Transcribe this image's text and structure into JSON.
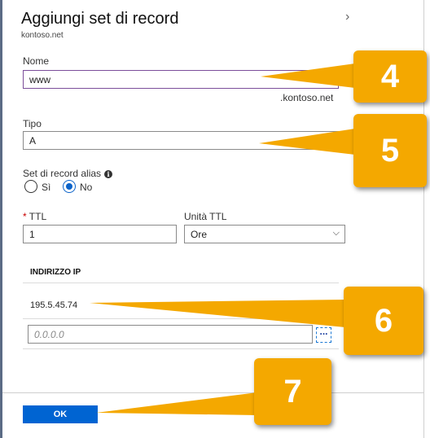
{
  "panel": {
    "title": "Aggiungi set di record",
    "subtitle": "kontoso.net",
    "close_glyph": "›"
  },
  "nome": {
    "label": "Nome",
    "value": "www",
    "suffix": ".kontoso.net"
  },
  "tipo": {
    "label": "Tipo",
    "value": "A"
  },
  "alias": {
    "label": "Set di record alias",
    "info_icon": "info-icon",
    "options": [
      {
        "label": "Sì",
        "selected": false
      },
      {
        "label": "No",
        "selected": true
      }
    ]
  },
  "ttl": {
    "required_marker": "*",
    "label": "TTL",
    "value": "1"
  },
  "ttl_unit": {
    "label": "Unità TTL",
    "value": "Ore",
    "chevron_glyph": "⌵"
  },
  "ip": {
    "header": "INDIRIZZO IP",
    "values": [
      "195.5.45.74"
    ],
    "placeholder": "0.0.0.0",
    "more_glyph": "..."
  },
  "footer": {
    "ok_label": "OK"
  },
  "callouts": [
    "4",
    "5",
    "6",
    "7"
  ],
  "colors": {
    "callout": "#f4a800",
    "primary_button": "#0064d2",
    "radio_selected": "#0b63c9",
    "focus_border": "#7c4e9a"
  }
}
